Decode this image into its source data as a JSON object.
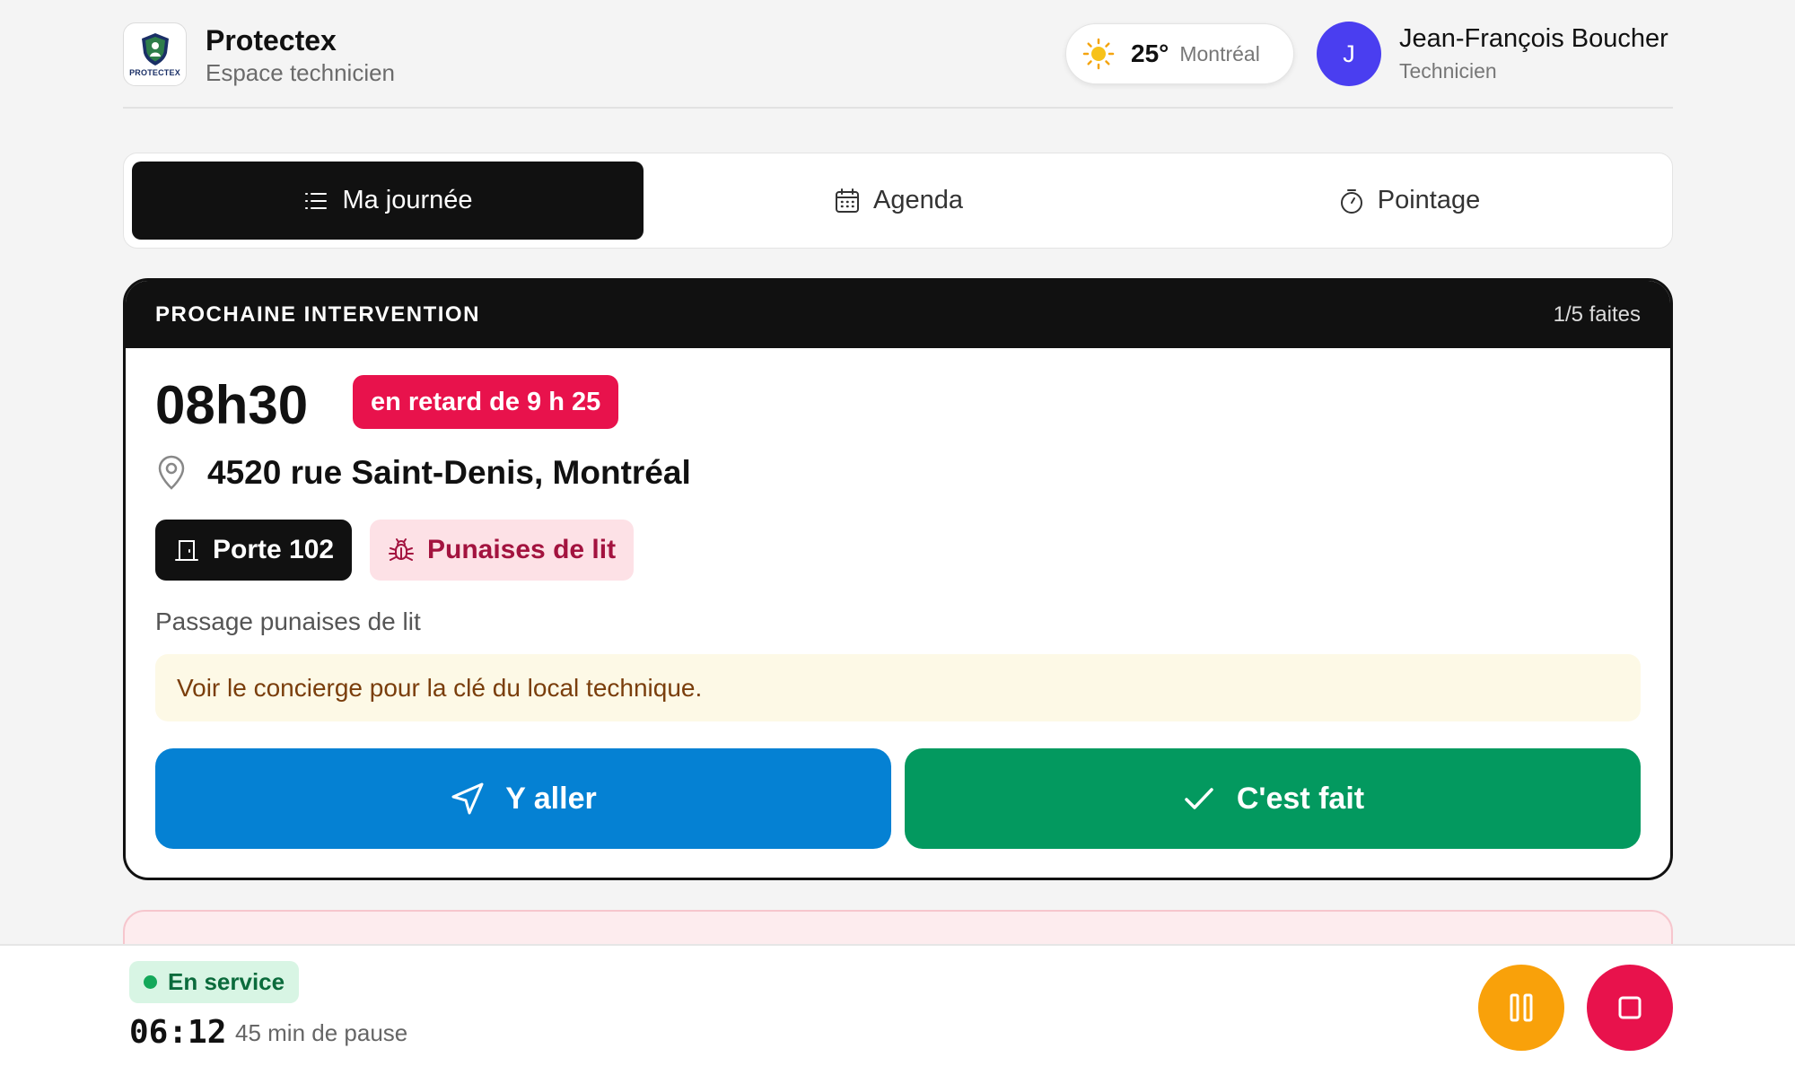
{
  "header": {
    "logo_text": "PROTECTEX",
    "app_name": "Protectex",
    "app_subtitle": "Espace technicien",
    "weather": {
      "temperature": "25°",
      "city": "Montréal",
      "icon": "sun-icon"
    },
    "user": {
      "initial": "J",
      "name": "Jean-François Boucher",
      "role": "Technicien",
      "avatar_color": "#4a3ef0"
    }
  },
  "tabs": [
    {
      "label": "Ma journée",
      "icon": "list-icon",
      "active": true
    },
    {
      "label": "Agenda",
      "icon": "calendar-icon",
      "active": false
    },
    {
      "label": "Pointage",
      "icon": "stopwatch-icon",
      "active": false
    }
  ],
  "intervention": {
    "section_label": "PROCHAINE INTERVENTION",
    "progress": "1/5 faites",
    "time": "08h30",
    "late_badge": "en retard de 9 h 25",
    "address": "4520 rue Saint-Denis, Montréal",
    "door": "Porte 102",
    "pest_type": "Punaises de lit",
    "description": "Passage punaises de lit",
    "note": "Voir le concierge pour la clé du local technique.",
    "go_button": "Y aller",
    "done_button": "C'est fait"
  },
  "bottom_bar": {
    "status": "En service",
    "elapsed": "06:12",
    "pause_info": "45 min de pause",
    "pause_button_icon": "pause-icon",
    "stop_button_icon": "stop-icon"
  },
  "colors": {
    "late": "#e8124c",
    "go": "#0581d3",
    "done": "#03995f",
    "pause": "#f9a10a",
    "stop": "#e8124c",
    "status_bg": "#d8f5e4"
  }
}
